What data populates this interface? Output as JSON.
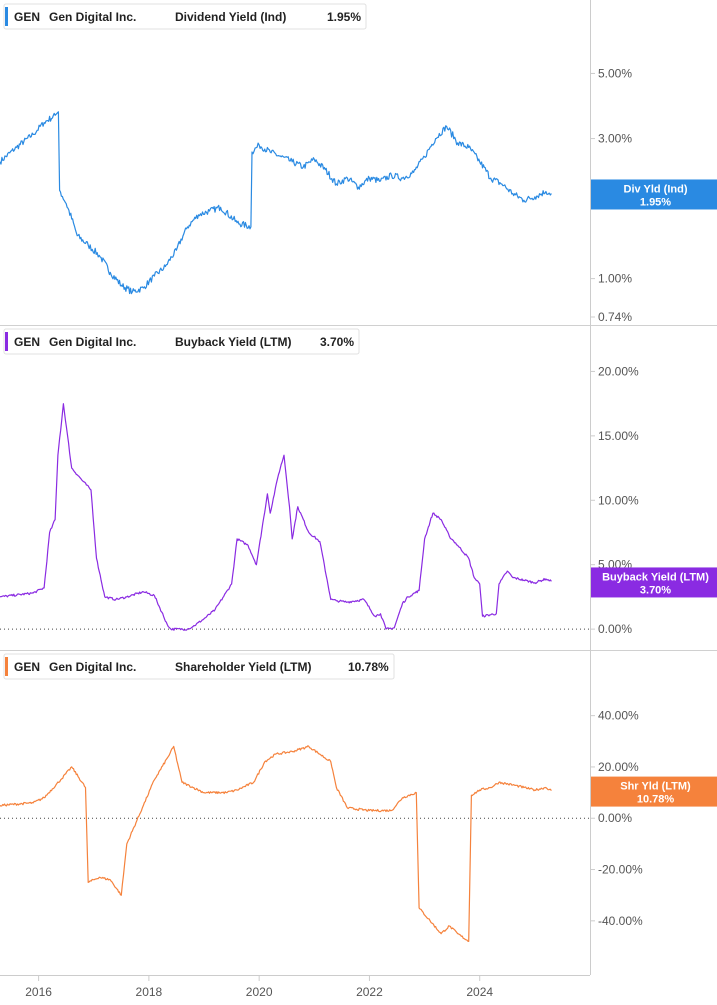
{
  "chart_data": [
    {
      "type": "line",
      "ticker": "GEN",
      "company": "Gen Digital Inc.",
      "metric": "Dividend Yield (Ind)",
      "current_value": "1.95%",
      "badge_label": "Div Yld (Ind)",
      "badge_value": "1.95%",
      "color": "#2a8ae2",
      "scale": "log",
      "ylim": [
        0.74,
        6.5
      ],
      "y_ticks": [
        {
          "v": 5.0,
          "label": "5.00%"
        },
        {
          "v": 3.0,
          "label": "3.00%"
        },
        {
          "v": 1.0,
          "label": "1.00%"
        },
        {
          "v": 0.74,
          "label": "0.74%"
        }
      ],
      "zero_line": false,
      "x": [
        2015.3,
        2015.6,
        2015.9,
        2016.1,
        2016.3,
        2016.36,
        2016.38,
        2016.5,
        2016.7,
        2016.9,
        2017.1,
        2017.3,
        2017.5,
        2017.7,
        2017.9,
        2018.1,
        2018.3,
        2018.5,
        2018.7,
        2018.9,
        2019.1,
        2019.3,
        2019.6,
        2019.85,
        2019.87,
        2020.0,
        2020.2,
        2020.4,
        2020.6,
        2020.8,
        2021.0,
        2021.2,
        2021.4,
        2021.6,
        2021.8,
        2022.0,
        2022.2,
        2022.4,
        2022.6,
        2022.8,
        2023.0,
        2023.2,
        2023.4,
        2023.6,
        2023.8,
        2024.0,
        2024.2,
        2024.4,
        2024.6,
        2024.8,
        2025.0,
        2025.2,
        2025.3
      ],
      "y": [
        2.5,
        2.8,
        3.1,
        3.4,
        3.6,
        3.7,
        2.0,
        1.8,
        1.4,
        1.3,
        1.2,
        1.05,
        0.95,
        0.9,
        0.93,
        1.02,
        1.1,
        1.25,
        1.5,
        1.65,
        1.7,
        1.75,
        1.55,
        1.5,
        2.7,
        2.85,
        2.7,
        2.6,
        2.5,
        2.4,
        2.55,
        2.35,
        2.1,
        2.2,
        2.05,
        2.2,
        2.15,
        2.25,
        2.2,
        2.3,
        2.6,
        3.0,
        3.3,
        2.9,
        2.8,
        2.5,
        2.2,
        2.1,
        1.95,
        1.85,
        1.9,
        1.98,
        1.95
      ]
    },
    {
      "type": "line",
      "ticker": "GEN",
      "company": "Gen Digital Inc.",
      "metric": "Buyback Yield (LTM)",
      "current_value": "3.70%",
      "badge_label": "Buyback Yield (LTM)",
      "badge_value": "3.70%",
      "color": "#8a2be2",
      "scale": "linear",
      "ylim": [
        -1.0,
        20.5
      ],
      "y_ticks": [
        {
          "v": 20,
          "label": "20.00%"
        },
        {
          "v": 15,
          "label": "15.00%"
        },
        {
          "v": 10,
          "label": "10.00%"
        },
        {
          "v": 5,
          "label": "5.00%"
        },
        {
          "v": 0,
          "label": "0.00%"
        }
      ],
      "zero_line": true,
      "x": [
        2015.3,
        2015.9,
        2016.1,
        2016.2,
        2016.3,
        2016.35,
        2016.45,
        2016.6,
        2016.8,
        2016.95,
        2017.05,
        2017.2,
        2017.4,
        2017.6,
        2017.9,
        2018.1,
        2018.35,
        2018.4,
        2018.7,
        2018.8,
        2019.0,
        2019.2,
        2019.5,
        2019.6,
        2019.8,
        2019.95,
        2020.15,
        2020.2,
        2020.35,
        2020.45,
        2020.55,
        2020.6,
        2020.7,
        2020.9,
        2021.1,
        2021.3,
        2021.4,
        2021.6,
        2021.9,
        2022.1,
        2022.2,
        2022.3,
        2022.45,
        2022.6,
        2022.7,
        2022.9,
        2023.0,
        2023.15,
        2023.3,
        2023.45,
        2023.6,
        2023.8,
        2023.9,
        2024.0,
        2024.05,
        2024.3,
        2024.35,
        2024.5,
        2024.6,
        2024.8,
        2025.0,
        2025.2,
        2025.3
      ],
      "y": [
        2.5,
        2.8,
        3.2,
        7.5,
        8.5,
        13.5,
        17.5,
        12.5,
        11.5,
        10.8,
        5.5,
        2.5,
        2.3,
        2.5,
        2.9,
        2.6,
        0.2,
        0.0,
        0.0,
        0.2,
        0.8,
        1.5,
        3.5,
        7.0,
        6.5,
        5.0,
        10.5,
        9.0,
        12.0,
        13.5,
        9.5,
        7.0,
        9.5,
        7.5,
        6.8,
        2.3,
        2.2,
        2.1,
        2.3,
        1.0,
        1.2,
        0.0,
        0.1,
        2.0,
        2.5,
        3.0,
        7.0,
        9.0,
        8.5,
        7.2,
        6.5,
        5.5,
        4.0,
        3.5,
        1.0,
        1.2,
        3.5,
        4.5,
        4.0,
        3.8,
        3.6,
        3.9,
        3.7
      ]
    },
    {
      "type": "line",
      "ticker": "GEN",
      "company": "Gen Digital Inc.",
      "metric": "Shareholder Yield (LTM)",
      "current_value": "10.78%",
      "badge_label": "Shr Yld (LTM)",
      "badge_value": "10.78%",
      "color": "#f5823c",
      "scale": "linear",
      "ylim": [
        -58,
        50
      ],
      "y_ticks": [
        {
          "v": 40,
          "label": "40.00%"
        },
        {
          "v": 20,
          "label": "20.00%"
        },
        {
          "v": 0,
          "label": "0.00%"
        },
        {
          "v": -20,
          "label": "-20.00%"
        },
        {
          "v": -40,
          "label": "-40.00%"
        }
      ],
      "zero_line": true,
      "x": [
        2015.3,
        2015.9,
        2016.1,
        2016.4,
        2016.6,
        2016.85,
        2016.9,
        2017.1,
        2017.3,
        2017.5,
        2017.6,
        2017.9,
        2018.1,
        2018.35,
        2018.45,
        2018.6,
        2018.8,
        2019.0,
        2019.4,
        2019.6,
        2019.9,
        2020.1,
        2020.3,
        2020.6,
        2020.9,
        2021.1,
        2021.3,
        2021.4,
        2021.6,
        2022.0,
        2022.4,
        2022.6,
        2022.85,
        2022.9,
        2023.1,
        2023.3,
        2023.45,
        2023.6,
        2023.8,
        2023.85,
        2024.0,
        2024.2,
        2024.35,
        2024.6,
        2024.8,
        2025.0,
        2025.2,
        2025.3
      ],
      "y": [
        5,
        6,
        8,
        15,
        20,
        12,
        -25,
        -23,
        -24,
        -30,
        -10,
        5,
        15,
        24,
        28,
        14,
        12,
        10,
        10,
        11,
        14,
        22,
        25,
        26,
        28,
        25,
        22,
        12,
        4,
        3,
        3,
        8,
        10,
        -35,
        -40,
        -45,
        -42,
        -45,
        -48,
        9,
        11,
        12,
        14,
        13,
        12,
        11,
        12,
        10.78
      ]
    }
  ],
  "x_axis": {
    "labels": [
      {
        "v": 2016,
        "label": "2016"
      },
      {
        "v": 2018,
        "label": "2018"
      },
      {
        "v": 2020,
        "label": "2020"
      },
      {
        "v": 2022,
        "label": "2022"
      },
      {
        "v": 2024,
        "label": "2024"
      }
    ],
    "range": [
      2015.3,
      2026.0
    ]
  }
}
